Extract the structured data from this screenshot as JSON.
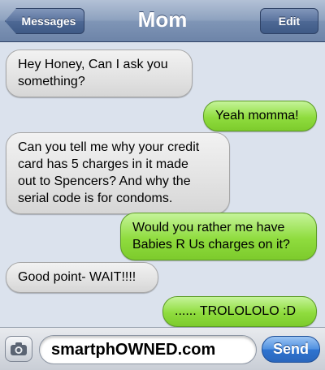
{
  "header": {
    "back_label": "Messages",
    "title": "Mom",
    "edit_label": "Edit"
  },
  "messages": [
    {
      "side": "received",
      "text_lines": [
        "Hey Honey, Can I ask you",
        "something?"
      ]
    },
    {
      "side": "sent",
      "text_lines": [
        "Yeah momma!"
      ]
    },
    {
      "side": "received",
      "text_lines": [
        "Can you tell me why your credit",
        "card has 5 charges in it made",
        "out to Spencers? And why the",
        "serial code is for condoms."
      ]
    },
    {
      "side": "sent",
      "text_lines": [
        "Would you rather me have",
        "Babies R Us charges on it?"
      ]
    },
    {
      "side": "received",
      "text_lines": [
        "Good point- WAIT!!!!"
      ]
    },
    {
      "side": "sent",
      "text_lines": [
        "...... TROLOLOLO :D"
      ]
    }
  ],
  "input": {
    "value": "smartphOWNED.com",
    "send_label": "Send"
  },
  "colors": {
    "sent_bubble": "#8fdc3e",
    "received_bubble": "#e2e2e2",
    "send_button": "#2f74d0",
    "nav_bar": "#8ea2bf"
  },
  "icons": {
    "camera": "camera-icon"
  }
}
